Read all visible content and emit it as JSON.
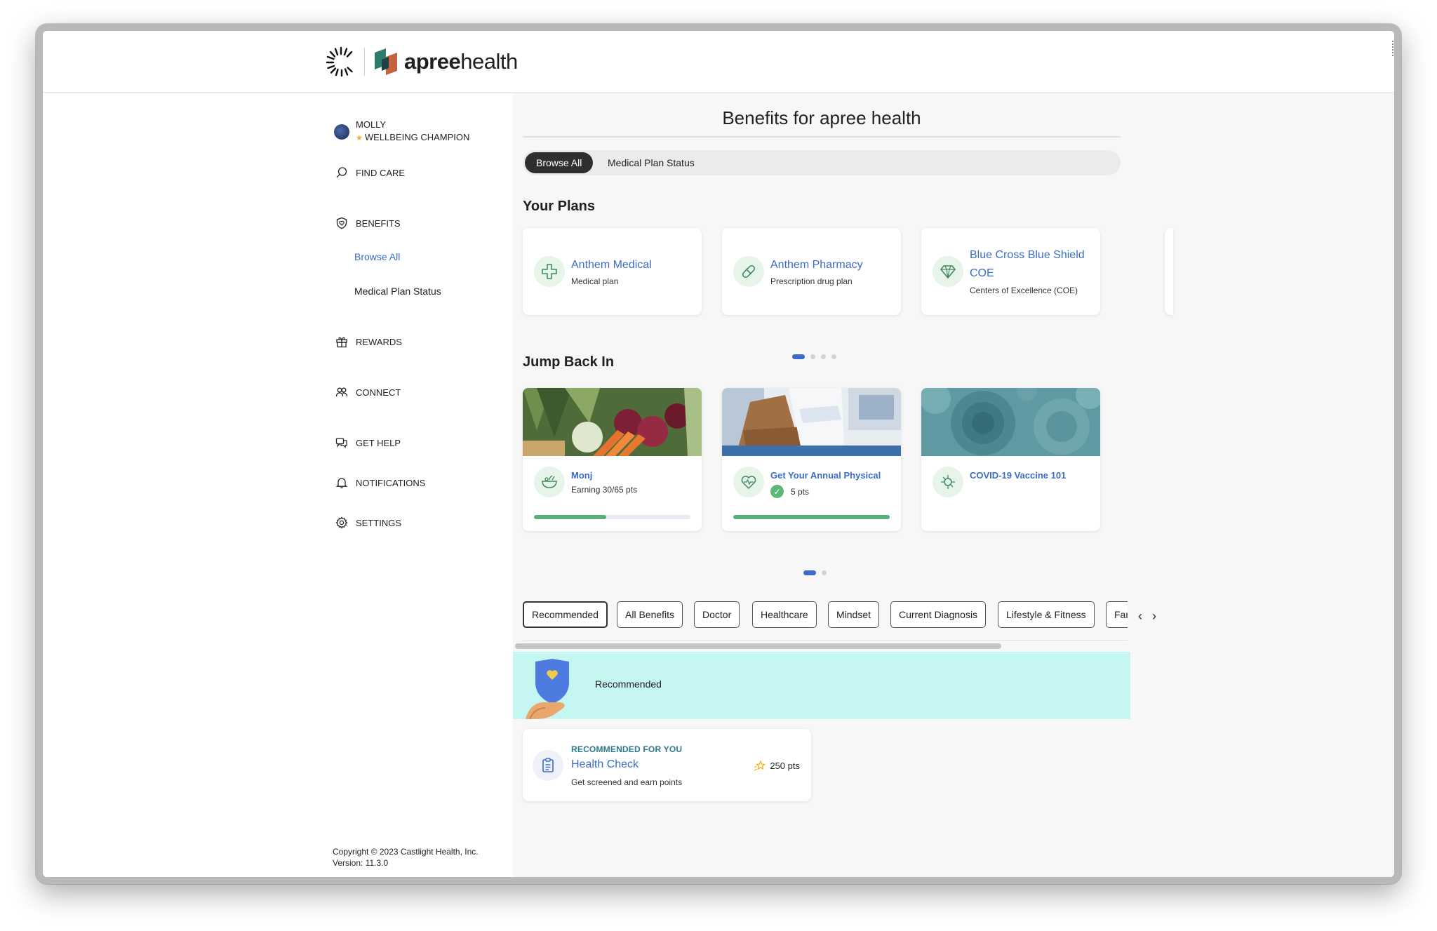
{
  "brand": {
    "word_bold": "apree",
    "word_light": "health",
    "logo_colors": [
      "#2f7a6b",
      "#c4633f",
      "#1f3f4a"
    ]
  },
  "user": {
    "name": "MOLLY",
    "role": "WELLBEING CHAMPION"
  },
  "nav": {
    "find_care": "FIND CARE",
    "benefits": "BENEFITS",
    "browse_all": "Browse All",
    "medical_plan_status": "Medical Plan Status",
    "rewards": "REWARDS",
    "connect": "CONNECT",
    "get_help": "GET HELP",
    "notifications": "NOTIFICATIONS",
    "settings": "SETTINGS"
  },
  "footer": {
    "copyright": "Copyright © 2023 Castlight Health, Inc.",
    "version": "Version: 11.3.0"
  },
  "page": {
    "title": "Benefits for apree health",
    "tabs": [
      "Browse All",
      "Medical Plan Status"
    ]
  },
  "your_plans": {
    "heading": "Your Plans",
    "cards": [
      {
        "title": "Anthem Medical",
        "subtitle": "Medical plan",
        "icon": "medical-cross-icon"
      },
      {
        "title": "Anthem Pharmacy",
        "subtitle": "Prescription drug plan",
        "icon": "pill-icon"
      },
      {
        "title": "Blue Cross Blue Shield COE",
        "subtitle": "Centers of Excellence (COE)",
        "icon": "diamond-icon"
      }
    ],
    "carousel_pages": 4,
    "carousel_active": 1
  },
  "jump_back_in": {
    "heading": "Jump Back In",
    "cards": [
      {
        "title": "Monj",
        "subtitle": "Earning 30/65 pts",
        "progress": 0.46,
        "icon": "bowl-icon"
      },
      {
        "title": "Get Your Annual Physical",
        "subtitle": "5 pts",
        "progress": 1.0,
        "icon": "heart-pulse-icon"
      },
      {
        "title": "COVID-19 Vaccine 101",
        "subtitle": "",
        "icon": "virus-icon"
      }
    ],
    "carousel_pages": 2,
    "carousel_active": 1
  },
  "filters": {
    "chips": [
      "Recommended",
      "All Benefits",
      "Doctor",
      "Healthcare",
      "Mindset",
      "Current Diagnosis",
      "Lifestyle & Fitness",
      "Fam"
    ],
    "selected": "Recommended"
  },
  "banner": {
    "label": "Recommended",
    "color": "#c5f6f1"
  },
  "recommended_card": {
    "eyebrow": "RECOMMENDED FOR YOU",
    "title": "Health Check",
    "subtitle": "Get screened and earn points",
    "points": "250 pts"
  },
  "colors": {
    "accent_blue": "#3b6cc7",
    "progress_green": "#59b07a",
    "icon_bg_green": "#e7f4ea"
  }
}
